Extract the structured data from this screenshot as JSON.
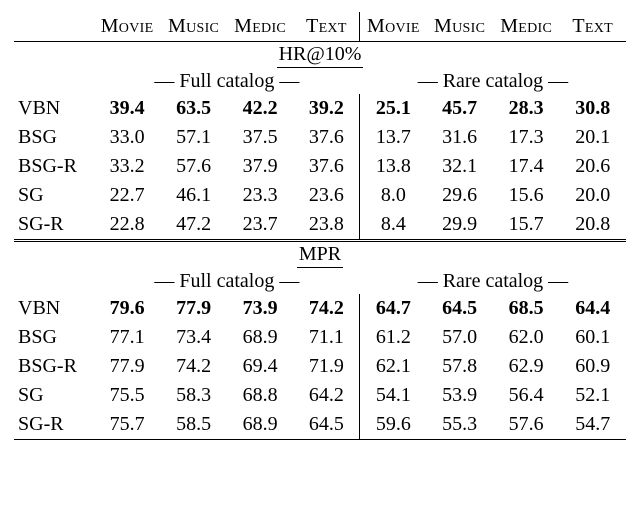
{
  "headers": {
    "cols": [
      "Movie",
      "Music",
      "Medic",
      "Text",
      "Movie",
      "Music",
      "Medic",
      "Text"
    ],
    "metric1": "HR@10%",
    "metric2": "MPR",
    "full": "— Full catalog —",
    "rare": "— Rare catalog —"
  },
  "methods": [
    "VBN",
    "BSG",
    "BSG-R",
    "SG",
    "SG-R"
  ],
  "chart_data": [
    {
      "type": "table",
      "title": "HR@10%",
      "sections": [
        "Full catalog",
        "Rare catalog"
      ],
      "columns": [
        "Movie",
        "Music",
        "Medic",
        "Text"
      ],
      "series": [
        {
          "name": "VBN",
          "full": [
            39.4,
            63.5,
            42.2,
            39.2
          ],
          "rare": [
            25.1,
            45.7,
            28.3,
            30.8
          ],
          "bold": true
        },
        {
          "name": "BSG",
          "full": [
            33.0,
            57.1,
            37.5,
            37.6
          ],
          "rare": [
            13.7,
            31.6,
            17.3,
            20.1
          ]
        },
        {
          "name": "BSG-R",
          "full": [
            33.2,
            57.6,
            37.9,
            37.6
          ],
          "rare": [
            13.8,
            32.1,
            17.4,
            20.6
          ]
        },
        {
          "name": "SG",
          "full": [
            22.7,
            46.1,
            23.3,
            23.6
          ],
          "rare": [
            8.0,
            29.6,
            15.6,
            20.0
          ]
        },
        {
          "name": "SG-R",
          "full": [
            22.8,
            47.2,
            23.7,
            23.8
          ],
          "rare": [
            8.4,
            29.9,
            15.7,
            20.8
          ]
        }
      ]
    },
    {
      "type": "table",
      "title": "MPR",
      "sections": [
        "Full catalog",
        "Rare catalog"
      ],
      "columns": [
        "Movie",
        "Music",
        "Medic",
        "Text"
      ],
      "series": [
        {
          "name": "VBN",
          "full": [
            79.6,
            77.9,
            73.9,
            74.2
          ],
          "rare": [
            64.7,
            64.5,
            68.5,
            64.4
          ],
          "bold": true
        },
        {
          "name": "BSG",
          "full": [
            77.1,
            73.4,
            68.9,
            71.1
          ],
          "rare": [
            61.2,
            57.0,
            62.0,
            60.1
          ]
        },
        {
          "name": "BSG-R",
          "full": [
            77.9,
            74.2,
            69.4,
            71.9
          ],
          "rare": [
            62.1,
            57.8,
            62.9,
            60.9
          ]
        },
        {
          "name": "SG",
          "full": [
            75.5,
            58.3,
            68.8,
            64.2
          ],
          "rare": [
            54.1,
            53.9,
            56.4,
            52.1
          ]
        },
        {
          "name": "SG-R",
          "full": [
            75.7,
            58.5,
            68.9,
            64.5
          ],
          "rare": [
            59.6,
            55.3,
            57.6,
            54.7
          ]
        }
      ]
    }
  ]
}
